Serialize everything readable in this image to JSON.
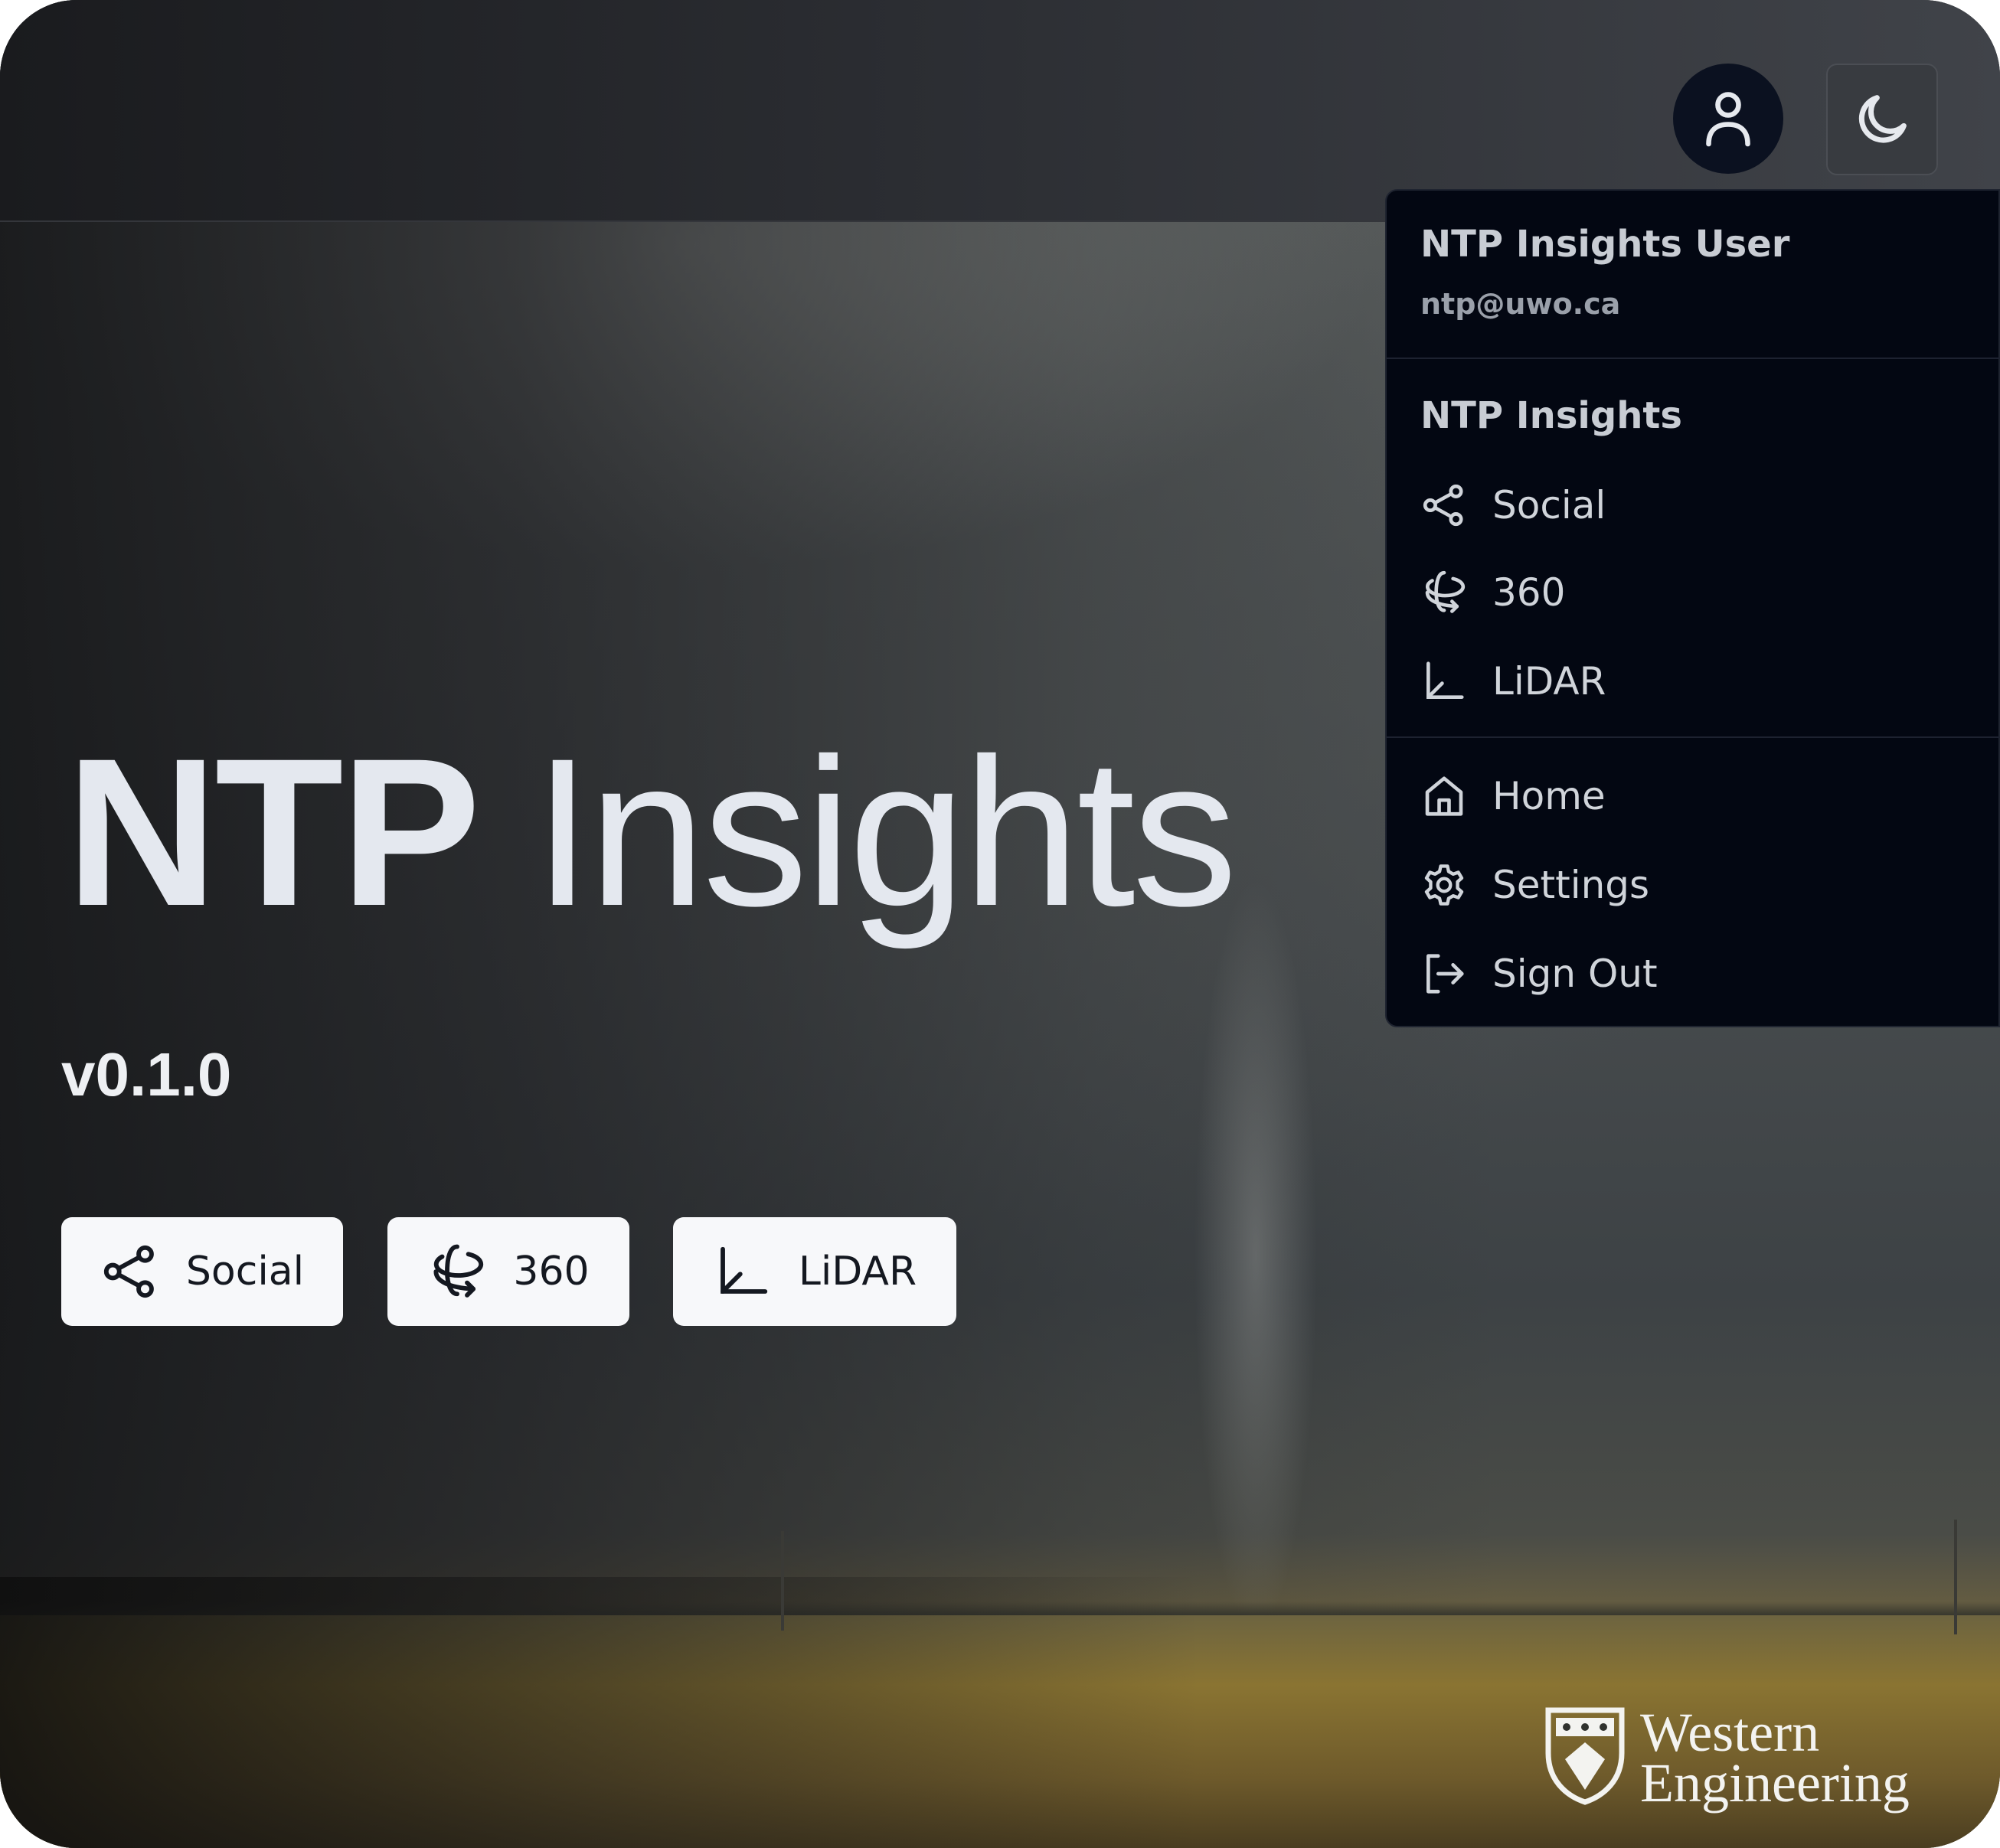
{
  "header": {
    "user_button_icon": "user-icon",
    "theme_button_icon": "moon-icon"
  },
  "user_menu": {
    "name": "NTP Insights User",
    "email": "ntp@uwo.ca",
    "section_title": "NTP Insights",
    "app_items": [
      {
        "label": "Social",
        "icon": "share-icon"
      },
      {
        "label": "360",
        "icon": "rotate-3d-icon"
      },
      {
        "label": "LiDAR",
        "icon": "axis-icon"
      }
    ],
    "nav_items": [
      {
        "label": "Home",
        "icon": "home-icon"
      },
      {
        "label": "Settings",
        "icon": "gear-icon"
      },
      {
        "label": "Sign Out",
        "icon": "sign-out-icon"
      }
    ]
  },
  "hero": {
    "title_bold": "NTP",
    "title_light": "Insights",
    "version": "v0.1.0",
    "buttons": [
      {
        "label": "Social",
        "icon": "share-icon"
      },
      {
        "label": "360",
        "icon": "rotate-3d-icon"
      },
      {
        "label": "LiDAR",
        "icon": "axis-icon"
      }
    ]
  },
  "footer": {
    "logo_line1": "Western",
    "logo_line2": "Engineering"
  },
  "colors": {
    "menu_bg": "#030712",
    "button_bg": "#f7f8fa",
    "avatar_bg": "#0b1120"
  }
}
